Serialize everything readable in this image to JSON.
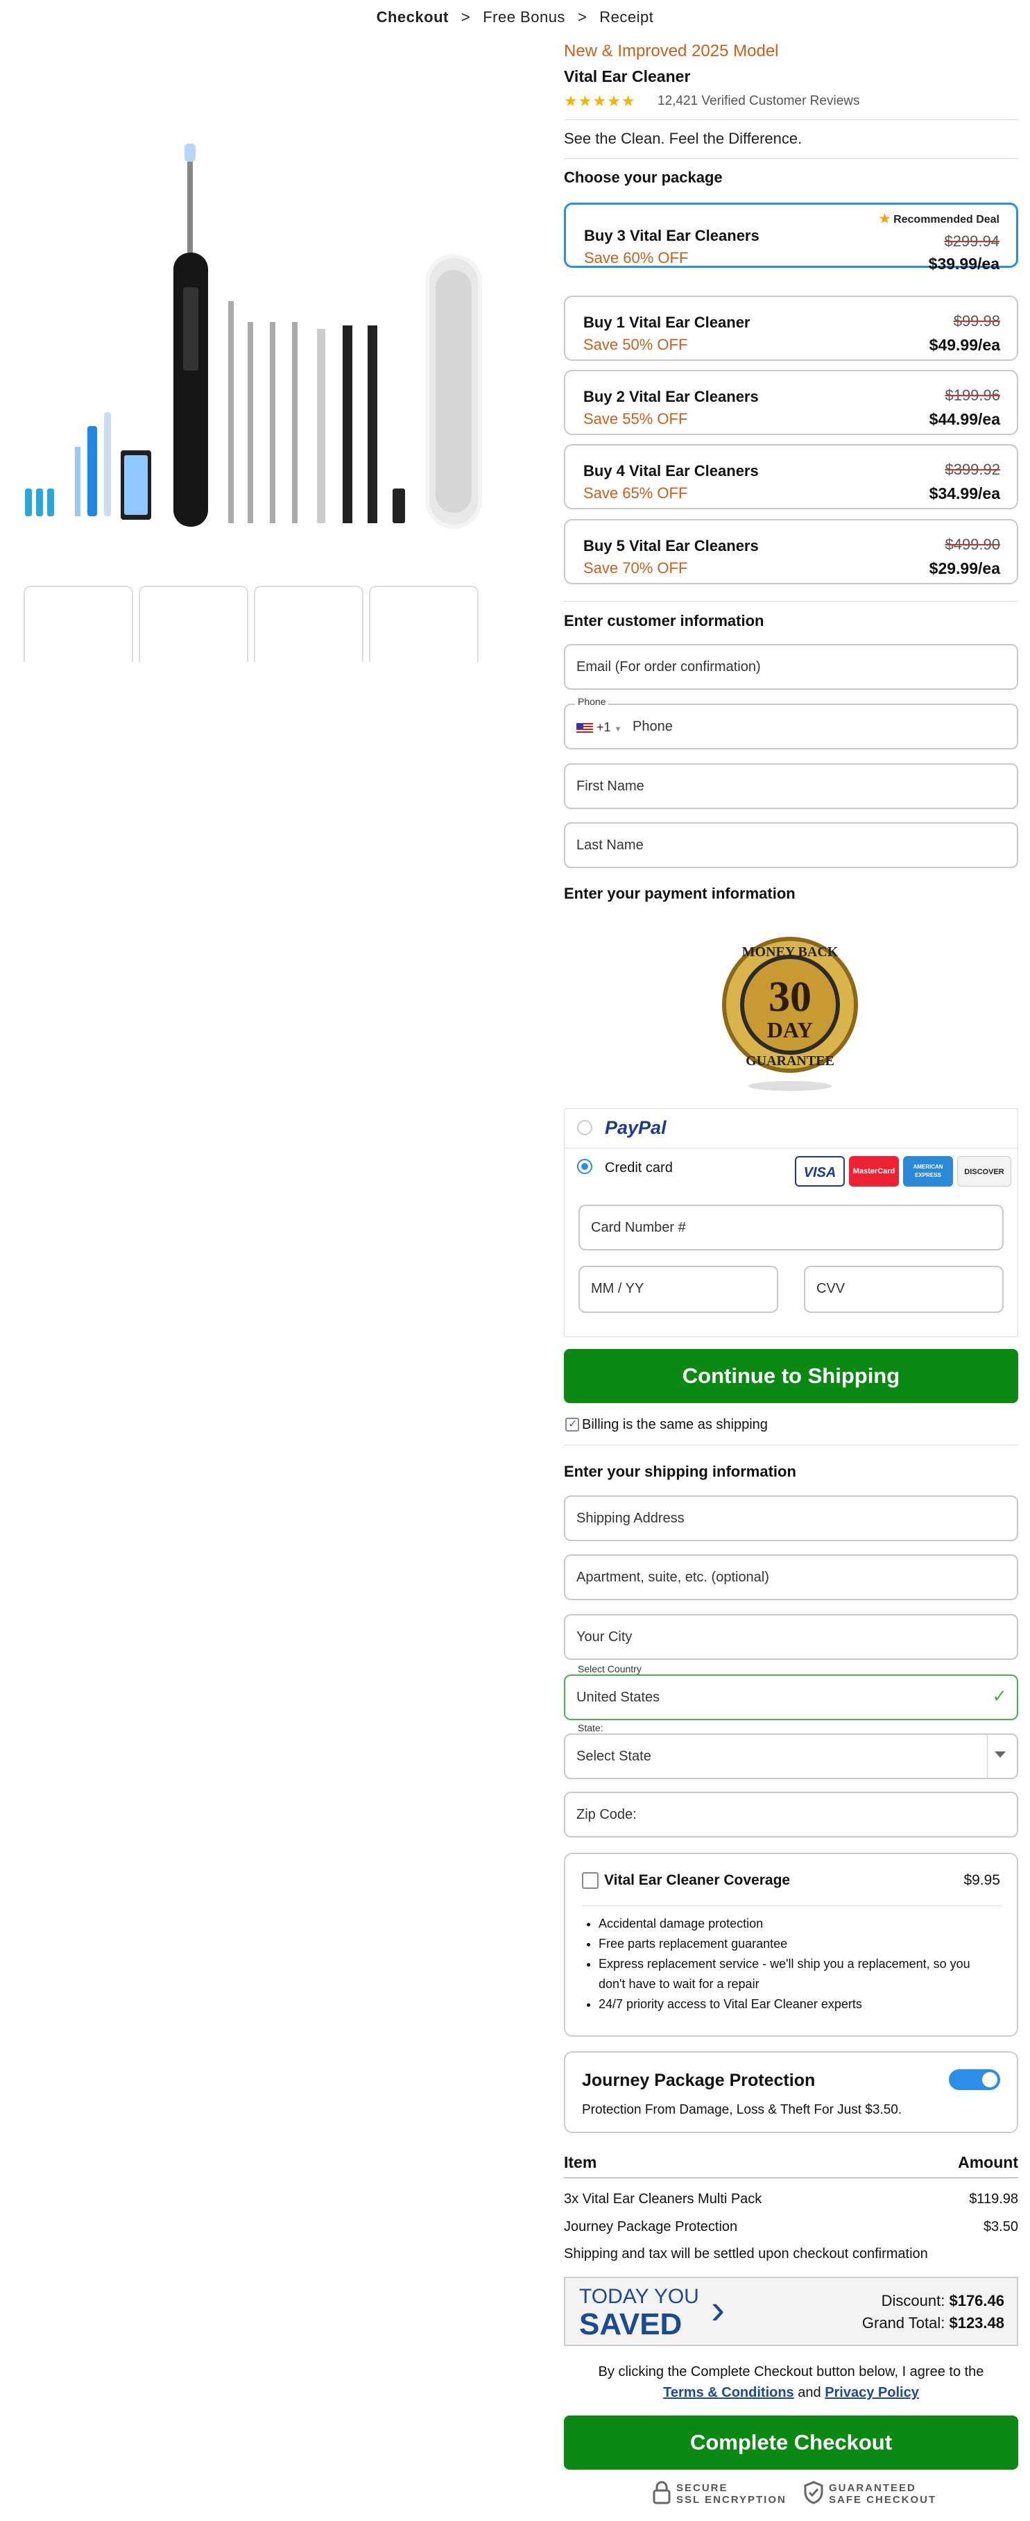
{
  "breadcrumb": {
    "step1": "Checkout",
    "step2": "Free Bonus",
    "step3": "Receipt",
    "sep": ">"
  },
  "product": {
    "badge": "New & Improved 2025 Model",
    "name": "Vital Ear Cleaner",
    "stars": "★★★★★",
    "reviews": "12,421 Verified Customer Reviews",
    "tagline": "See the Clean. Feel the Difference."
  },
  "packages": {
    "heading": "Choose your package",
    "recommended": "Recommended Deal",
    "items": [
      {
        "name": "Buy 3 Vital Ear Cleaners",
        "save": "Save 60% OFF",
        "old": "$299.94",
        "price": "$39.99/ea"
      },
      {
        "name": "Buy 1 Vital Ear Cleaner",
        "save": "Save 50% OFF",
        "old": "$99.98",
        "price": "$49.99/ea"
      },
      {
        "name": "Buy 2 Vital Ear Cleaners",
        "save": "Save 55% OFF",
        "old": "$199.96",
        "price": "$44.99/ea"
      },
      {
        "name": "Buy 4 Vital Ear Cleaners",
        "save": "Save 65% OFF",
        "old": "$399.92",
        "price": "$34.99/ea"
      },
      {
        "name": "Buy 5 Vital Ear Cleaners",
        "save": "Save 70% OFF",
        "old": "$499.90",
        "price": "$29.99/ea"
      }
    ]
  },
  "customer": {
    "heading": "Enter customer information",
    "email": "Email (For order confirmation)",
    "phone_label": "Phone",
    "phone_code": "+1",
    "phone": "Phone",
    "first": "First Name",
    "last": "Last Name"
  },
  "payment": {
    "heading": "Enter your payment information",
    "seal_top": "MONEY BACK",
    "seal_num": "30",
    "seal_day": "DAY",
    "seal_bottom": "GUARANTEE",
    "paypal": "PayPal",
    "credit": "Credit card",
    "cards": [
      "VISA",
      "MasterCard",
      "AMERICAN EXPRESS",
      "DISCOVER"
    ],
    "card_number": "Card Number #",
    "expiry": "MM / YY",
    "cvv": "CVV",
    "continue": "Continue to Shipping",
    "billing_same": "Billing is the same as shipping"
  },
  "shipping": {
    "heading": "Enter your shipping information",
    "address": "Shipping Address",
    "apt": "Apartment, suite, etc. (optional)",
    "city": "Your City",
    "country_label": "Select Country",
    "country": "United States",
    "state_label": "State:",
    "state": "Select State",
    "zip": "Zip Code:"
  },
  "coverage": {
    "title": "Vital Ear Cleaner Coverage",
    "price": "$9.95",
    "bullets": [
      "Accidental damage protection",
      "Free parts replacement guarantee",
      "Express replacement service - we'll ship you a replacement, so you don't have to wait for a repair",
      "24/7 priority access to Vital Ear Cleaner experts"
    ]
  },
  "protection": {
    "title": "Journey Package Protection",
    "desc": "Protection From Damage, Loss & Theft For Just $3.50."
  },
  "summary": {
    "item_h": "Item",
    "amount_h": "Amount",
    "rows": [
      {
        "item": "3x Vital Ear Cleaners Multi Pack",
        "amount": "$119.98"
      },
      {
        "item": "Journey Package Protection",
        "amount": "$3.50"
      }
    ],
    "note": "Shipping and tax will be settled upon checkout confirmation",
    "today": "TODAY YOU",
    "saved": "SAVED",
    "discount_label": "Discount:",
    "discount": "$176.46",
    "total_label": "Grand Total:",
    "total": "$123.48"
  },
  "legal": {
    "text": "By clicking the Complete Checkout button below, I agree to the",
    "terms": "Terms & Conditions",
    "and": "and",
    "privacy": "Privacy Policy"
  },
  "checkout": {
    "button": "Complete Checkout",
    "secure1": "SECURE",
    "secure2": "SSL ENCRYPTION",
    "safe1": "GUARANTEED",
    "safe2": "SAFE CHECKOUT"
  },
  "colors": {
    "accent": "#2a8ee6",
    "cta": "#0a8a12",
    "discount": "#c8601c"
  }
}
